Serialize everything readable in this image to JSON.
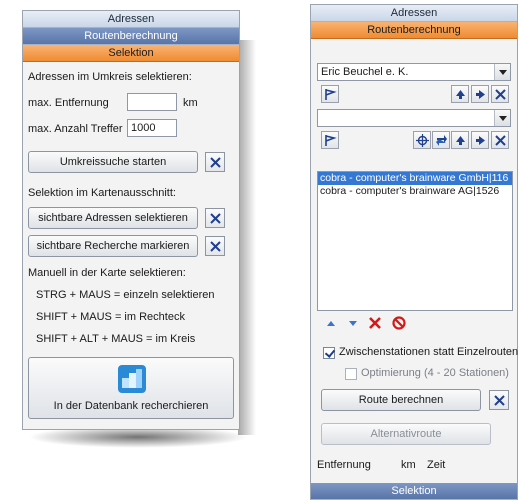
{
  "left_panel": {
    "headers": {
      "adressen": "Adressen",
      "routenberechnung": "Routenberechnung",
      "selektion": "Selektion"
    },
    "umkreis_label": "Adressen im Umkreis selektieren:",
    "max_entfernung_label": "max. Entfernung",
    "max_entfernung_value": "",
    "km_unit": "km",
    "max_treffer_label": "max. Anzahl Treffer",
    "max_treffer_value": "1000",
    "umkreissuche_button": "Umkreissuche starten",
    "kartenausschnitt_label": "Selektion im Kartenausschnitt:",
    "sichtbare_adressen_button": "sichtbare Adressen selektieren",
    "sichtbare_recherche_button": "sichtbare Recherche markieren",
    "manuell_label": "Manuell in der Karte selektieren:",
    "hint_strg": "STRG + MAUS = einzeln selektieren",
    "hint_shift": "SHIFT + MAUS = im Rechteck",
    "hint_shift_alt": "SHIFT + ALT + MAUS = im Kreis",
    "datenbank_button": "In der Datenbank recherchieren"
  },
  "right_panel": {
    "headers": {
      "adressen": "Adressen",
      "routenberechnung": "Routenberechnung",
      "selektion": "Selektion"
    },
    "start_select_value": "Eric Beuchel e. K.",
    "dest_select_value": "",
    "route_list": [
      "cobra - computer's brainware GmbH|116",
      "cobra - computer's brainware AG|1526"
    ],
    "zwischenstationen_label": "Zwischenstationen statt Einzelrouten",
    "optimierung_label": "Optimierung (4 - 20 Stationen)",
    "route_button": "Route berechnen",
    "alternativroute_button": "Alternativroute",
    "entfernung_label": "Entfernung",
    "km_label": "km",
    "zeit_label": "Zeit"
  },
  "colors": {
    "orange_header": "#ef8b32",
    "blue_header": "#c9d6e8",
    "list_selection": "#3478d4",
    "delete_red": "#d11a1a"
  }
}
